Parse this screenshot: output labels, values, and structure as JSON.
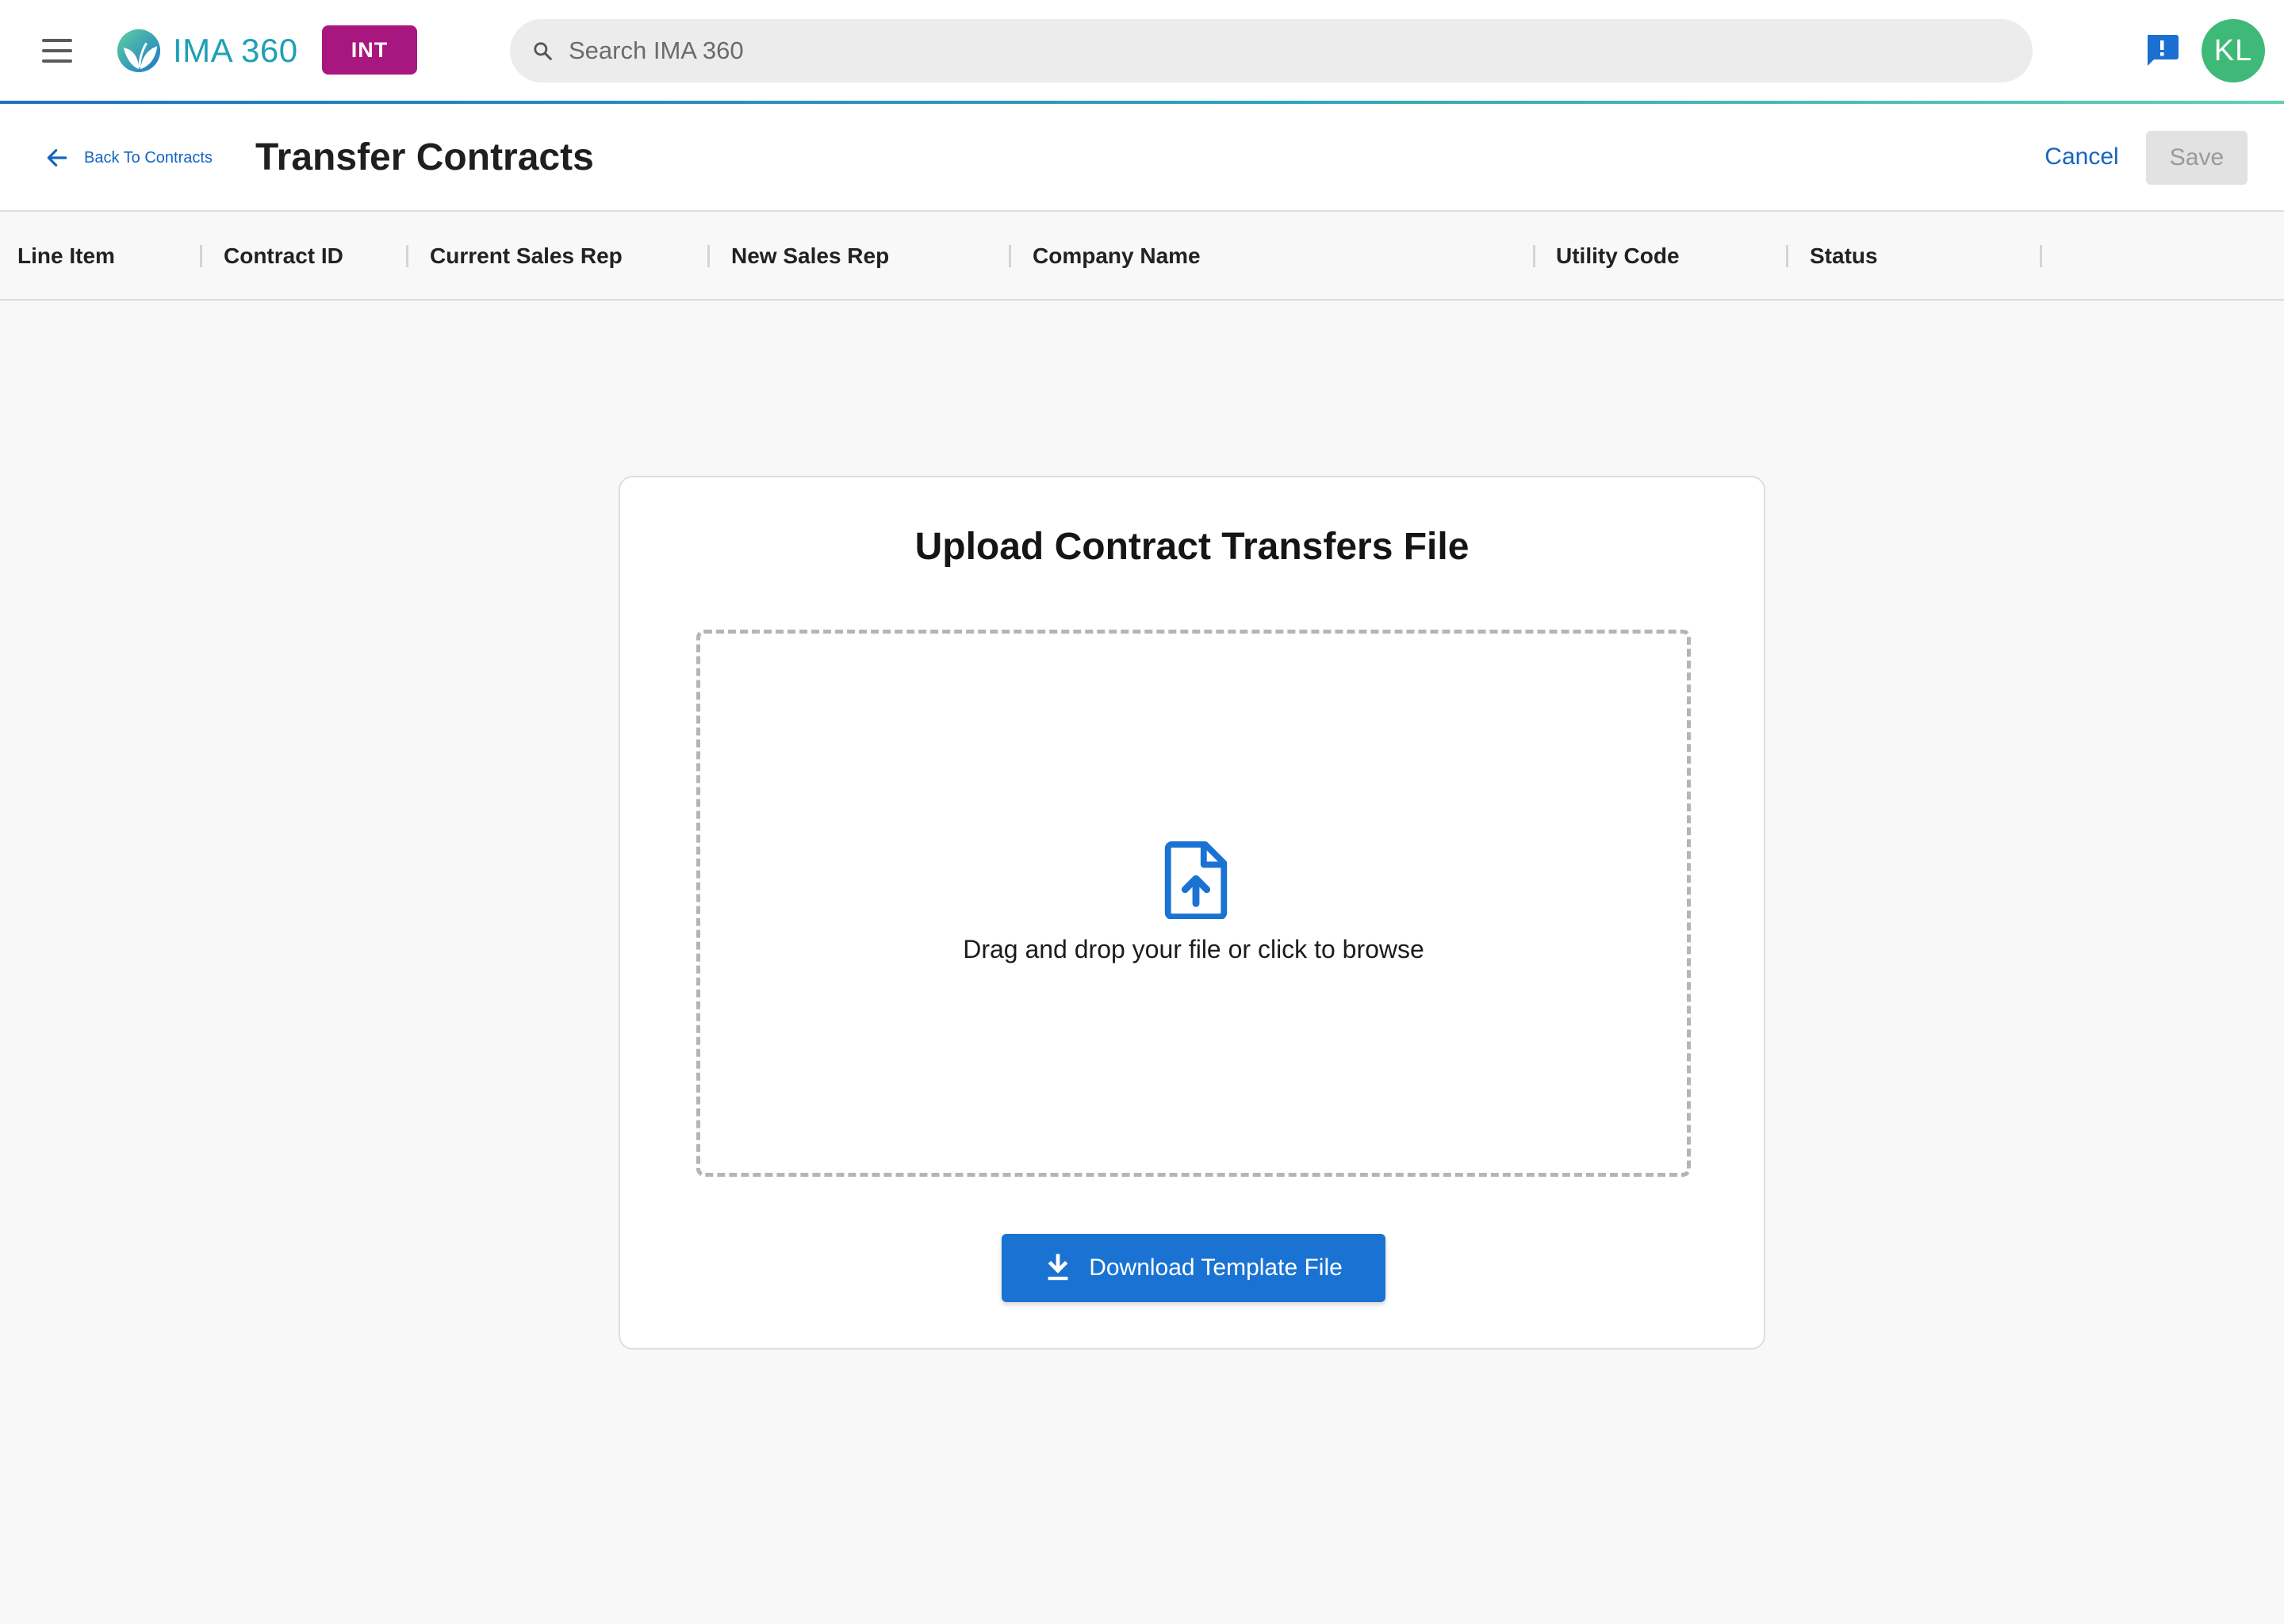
{
  "app": {
    "name": "IMA 360",
    "env_badge": "INT",
    "user_initials": "KL"
  },
  "search": {
    "placeholder": "Search IMA 360"
  },
  "header": {
    "back_label": "Back To Contracts",
    "title": "Transfer Contracts",
    "cancel_label": "Cancel",
    "save_label": "Save"
  },
  "table": {
    "columns": [
      "Line Item",
      "Contract ID",
      "Current Sales Rep",
      "New Sales Rep",
      "Company Name",
      "Utility Code",
      "Status"
    ]
  },
  "upload": {
    "title": "Upload Contract Transfers File",
    "drop_text": "Drag and drop your file or click to browse",
    "download_label": "Download Template File"
  },
  "colors": {
    "brand_teal": "#1fa0b4",
    "env_badge": "#a8177f",
    "primary_blue": "#1a73d2",
    "avatar_green": "#3fb977"
  },
  "icons": {
    "menu": "menu-icon",
    "search": "search-icon",
    "feedback": "feedback-icon",
    "back": "arrow-left-icon",
    "upload": "file-upload-icon",
    "download": "download-icon"
  }
}
